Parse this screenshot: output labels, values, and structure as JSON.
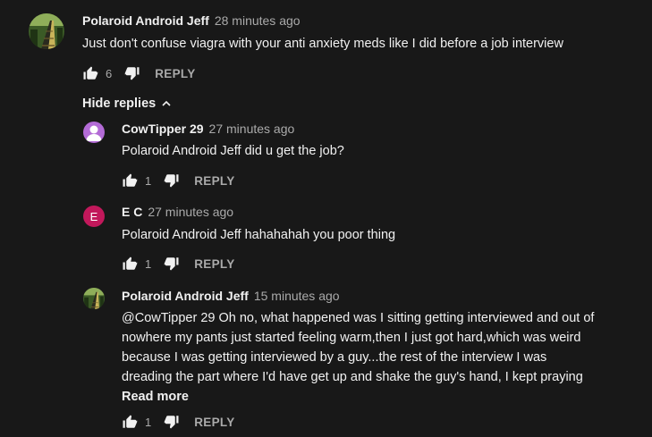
{
  "comments": [
    {
      "author": "Polaroid Android Jeff",
      "time": "28 minutes ago",
      "text": "Just don't  confuse viagra with your anti anxiety meds like I did before a job interview",
      "likes": "6",
      "reply_label": "REPLY",
      "avatar_icon": "railway-tracks-avatar"
    }
  ],
  "hide_replies_label": "Hide replies",
  "replies": [
    {
      "author": "CowTipper 29",
      "time": "27 minutes ago",
      "text": "Polaroid Android Jeff did u get the job?",
      "likes": "1",
      "reply_label": "REPLY",
      "avatar_icon": "user-silhouette-avatar",
      "avatar_color": "#b36bd6"
    },
    {
      "author": "E C",
      "time": "27 minutes ago",
      "text": "Polaroid Android Jeff  hahahahah you poor thing",
      "likes": "1",
      "reply_label": "REPLY",
      "avatar_letter": "E",
      "avatar_color": "#c2185b"
    },
    {
      "author": "Polaroid Android Jeff",
      "time": "15 minutes ago",
      "text_lines": [
        "@CowTipper 29 Oh no, what happened was I sitting getting interviewed and out of",
        "nowhere my pants just started feeling warm,then I just got hard,which was weird",
        "because I was getting interviewed by a guy...the rest of the interview I was",
        "dreading the part where I'd have get up and shake the guy's hand, I kept praying"
      ],
      "read_more_label": "Read more",
      "likes": "1",
      "reply_label": "REPLY",
      "avatar_icon": "railway-tracks-avatar"
    }
  ]
}
